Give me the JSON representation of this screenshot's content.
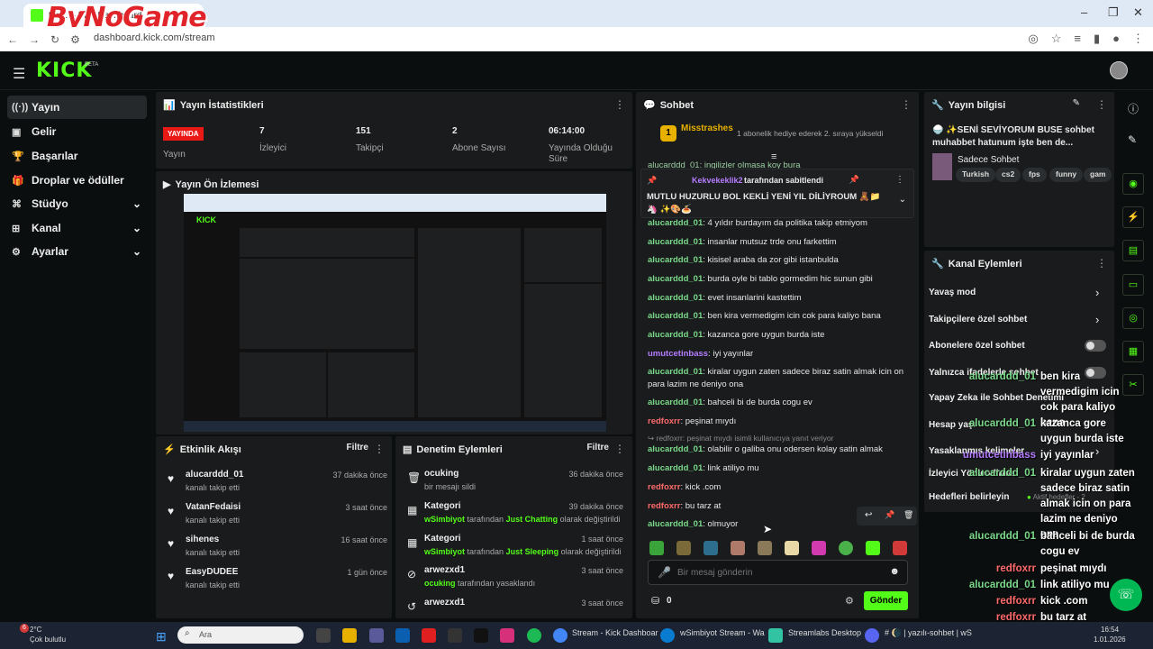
{
  "browser": {
    "tab_title": "tre… – Kick Dashboard",
    "brand": "ByNoGame",
    "url": "dashboard.kick.com/stream"
  },
  "kick": {
    "logo": "KICK",
    "beta": "BETA"
  },
  "sidebar": {
    "items": [
      {
        "label": "Yayın",
        "icon": "stream-icon"
      },
      {
        "label": "Gelir",
        "icon": "revenue-icon"
      },
      {
        "label": "Başarılar",
        "icon": "trophy-icon"
      },
      {
        "label": "Droplar ve ödüller",
        "icon": "gift-icon"
      },
      {
        "label": "Stüdyo",
        "icon": "studio-icon"
      },
      {
        "label": "Kanal",
        "icon": "channel-icon"
      },
      {
        "label": "Ayarlar",
        "icon": "settings-icon"
      }
    ]
  },
  "stats": {
    "title": "Yayın İstatistikleri",
    "live": "YAYINDA",
    "live_label": "Yayın",
    "viewers": "7",
    "viewers_label": "İzleyici",
    "followers": "151",
    "followers_label": "Takipçi",
    "subs": "2",
    "subs_label": "Abone Sayısı",
    "duration": "06:14:00",
    "duration_label": "Yayında Olduğu Süre"
  },
  "preview": {
    "title": "Yayın Ön İzlemesi"
  },
  "activity": {
    "title": "Etkinlik Akışı",
    "filter": "Filtre",
    "items": [
      {
        "name": "alucarddd_01",
        "sub": "kanalı takip etti",
        "time": "37 dakika önce"
      },
      {
        "name": "VatanFedaisi",
        "sub": "kanalı takip etti",
        "time": "3 saat önce"
      },
      {
        "name": "sihenes",
        "sub": "kanalı takip etti",
        "time": "16 saat önce"
      },
      {
        "name": "EasyDUDEE",
        "sub": "kanalı takip etti",
        "time": "1 gün önce"
      }
    ]
  },
  "moderation": {
    "title": "Denetim Eylemleri",
    "filter": "Filtre",
    "items": [
      {
        "name": "ocuking",
        "sub": "bir mesajı sildi",
        "time": "36 dakika önce"
      },
      {
        "name": "Kategori",
        "user": "wSimbiyot",
        "mid": "tarafından",
        "cat": "Just Chatting",
        "end": "olarak değiştirildi",
        "time": "39 dakika önce"
      },
      {
        "name": "Kategori",
        "user": "wSimbiyot",
        "mid": "tarafından",
        "cat": "Just Sleeping",
        "end": "olarak değiştirildi",
        "time": "1 saat önce"
      },
      {
        "name": "arwezxd1",
        "user": "ocuking",
        "mid": "tarafından yasaklandı",
        "time": "3 saat önce"
      },
      {
        "name": "arwezxd1",
        "time": "3 saat önce"
      }
    ]
  },
  "chat": {
    "title": "Sohbet",
    "top_gifter": "Misstrashes",
    "top_gifter_level": "1",
    "gift_note": "1 abonelik hediye ederek 2. sıraya yükseldi",
    "pinned_by": "Kekvekeklik2",
    "pinned_by_suffix": "tarafından sabitlendi",
    "pinned_text": "MUTLU HUZURLU BOL KEKLİ YENİ YIL DİLİYROUM 🧸📁🦄 ✨🎨🍝",
    "partial_top": "alucarddd_01: ingilizler olmasa koy bura",
    "reply_to": "↪ redfoxrr: peşinat mıydı isimli kullanıcıya yanıt veriyor",
    "messages": [
      {
        "user": "alucarddd_01",
        "text": "4 yıldır burdayım da politika takip etmiyom",
        "color": "#7bd98a"
      },
      {
        "user": "alucarddd_01",
        "text": "insanlar mutsuz trde onu farkettim",
        "color": "#7bd98a"
      },
      {
        "user": "alucarddd_01",
        "text": "kisisel araba da zor gibi istanbulda",
        "color": "#7bd98a"
      },
      {
        "user": "alucarddd_01",
        "text": "burda oyle bi tablo gormedim hic sunun gibi",
        "color": "#7bd98a"
      },
      {
        "user": "alucarddd_01",
        "text": "evet insanlarini kastettim",
        "color": "#7bd98a"
      },
      {
        "user": "alucarddd_01",
        "text": "ben kira vermedigim icin cok para kaliyo bana",
        "color": "#7bd98a"
      },
      {
        "user": "alucarddd_01",
        "text": "kazanca gore uygun burda iste",
        "color": "#7bd98a"
      },
      {
        "user": "umutcetinbass",
        "text": "iyi yayınlar",
        "color": "#b57cff"
      },
      {
        "user": "alucarddd_01",
        "text": "kiralar uygun zaten sadece biraz satin almak icin on para lazim ne deniyo ona",
        "color": "#7bd98a"
      },
      {
        "user": "alucarddd_01",
        "text": "bahceli bi de burda cogu ev",
        "color": "#7bd98a"
      },
      {
        "user": "redfoxrr",
        "text": "peşinat mıydı",
        "color": "#ff6b6b"
      },
      {
        "user": "alucarddd_01",
        "text": "olabilir o galiba onu odersen kolay satin almak",
        "color": "#7bd98a"
      },
      {
        "user": "alucarddd_01",
        "text": "link atiliyo mu",
        "color": "#7bd98a"
      },
      {
        "user": "redfoxrr",
        "text": "kick .com",
        "color": "#ff6b6b"
      },
      {
        "user": "redfoxrr",
        "text": "bu tarz at",
        "color": "#ff6b6b"
      },
      {
        "user": "alucarddd_01",
        "text": "olmuyor",
        "color": "#7bd98a"
      }
    ],
    "input_placeholder": "Bir mesaj gönderin",
    "points": "0",
    "send": "Gönder"
  },
  "stream_info": {
    "title": "Yayın bilgisi",
    "text": "🍚 ✨SENİ SEVİYORUM BUSE sohbet muhabbet hatunum işte ben de...",
    "category": "Sadece Sohbet",
    "tags": [
      "Turkish",
      "cs2",
      "fps",
      "funny",
      "gam"
    ]
  },
  "channel_actions": {
    "title": "Kanal Eylemleri",
    "rows": [
      "Yavaş mod",
      "Takipçilere özel sohbet",
      "Abonelere özel sohbet",
      "Yalnızca ifadelerle sohbet",
      "Yapay Zeka ile Sohbet Denetimi",
      "Hesap yaşı",
      "Yasaklanmış kelimeler",
      "İzleyici Yönlendirme",
      "Hedefleri belirleyin"
    ],
    "goal_status": "Aktif hedefler - 2"
  },
  "overlay": [
    {
      "user": "alucarddd_01",
      "text": "ben kira vermedigim icin cok para kaliyo bana"
    },
    {
      "user": "alucarddd_01",
      "text": "kazanca gore uygun burda iste"
    },
    {
      "user": "umutcetinbass",
      "text": "iyi yayınlar"
    },
    {
      "user": "alucarddd_01",
      "text": "kiralar uygun zaten sadece biraz satin almak icin on para lazim ne deniyo ona"
    },
    {
      "user": "alucarddd_01",
      "text": "bahceli bi de burda cogu ev"
    },
    {
      "user": "redfoxrr",
      "text": "peşinat mıydı"
    },
    {
      "user": "alucarddd_01",
      "text": "link atiliyo mu"
    },
    {
      "user": "redfoxrr",
      "text": "kick .com"
    },
    {
      "user": "redfoxrr",
      "text": "bu tarz at"
    },
    {
      "user": "alucarddd_01",
      "text": "olmuyor"
    }
  ],
  "taskbar": {
    "weather_temp": "2°C",
    "weather_desc": "Çok bulutlu",
    "weather_badge": "6",
    "search": "Ara",
    "apps": [
      "Stream - Kick Dashboar",
      "wSimbiyot Stream - Wa",
      "Streamlabs Desktop",
      "# 🌘 | yazılı-sohbet | wS"
    ],
    "time": "16:54",
    "date": "1.01.2026"
  },
  "colors": {
    "accent": "#53fc18",
    "live": "#e91916",
    "panel": "#191b1c"
  }
}
